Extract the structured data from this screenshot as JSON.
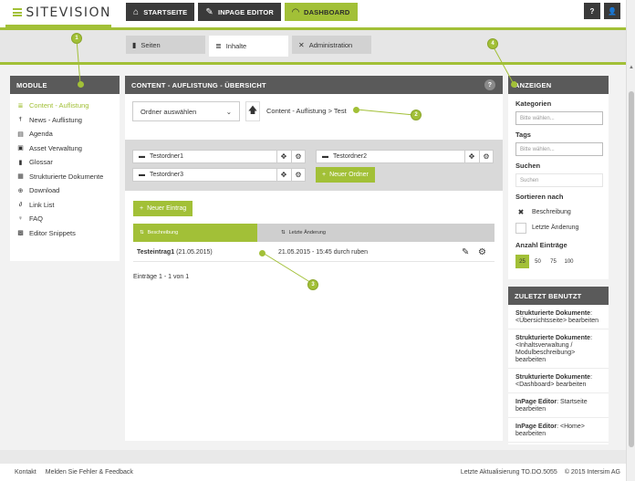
{
  "brand": {
    "logo_text": "SITEVISION"
  },
  "topnav": [
    {
      "label": "STARTSEITE",
      "icon": "home-icon",
      "glyph": "⌂"
    },
    {
      "label": "INPAGE EDITOR",
      "icon": "edit-icon",
      "glyph": "✎"
    },
    {
      "label": "DASHBOARD",
      "icon": "gauge-icon",
      "glyph": "◠"
    }
  ],
  "topicons": {
    "help": "?",
    "user": "👤"
  },
  "subtabs": [
    {
      "label": "Seiten",
      "glyph": "▮"
    },
    {
      "label": "Inhalte",
      "glyph": "≣"
    },
    {
      "label": "Administration",
      "glyph": "✕"
    }
  ],
  "modules": {
    "title": "MODULE",
    "items": [
      {
        "label": "Content - Auflistung",
        "glyph": "≣"
      },
      {
        "label": "News - Auflistung",
        "glyph": "ⲯ"
      },
      {
        "label": "Agenda",
        "glyph": "▤"
      },
      {
        "label": "Asset Verwaltung",
        "glyph": "▣"
      },
      {
        "label": "Glossar",
        "glyph": "▮"
      },
      {
        "label": "Strukturierte Dokumente",
        "glyph": "▦"
      },
      {
        "label": "Download",
        "glyph": "⊕"
      },
      {
        "label": "Link List",
        "glyph": "∂"
      },
      {
        "label": "FAQ",
        "glyph": "♀"
      },
      {
        "label": "Editor Snippets",
        "glyph": "▩"
      }
    ]
  },
  "content": {
    "title": "CONTENT - AUFLISTUNG - ÜBERSICHT",
    "help": "?",
    "folder_select": "Ordner auswählen",
    "breadcrumb": {
      "parent": "Content - Auflistung",
      "sep": ">",
      "current": "Test"
    },
    "folders": [
      "Testordner1",
      "Testordner2",
      "Testordner3"
    ],
    "new_folder_label": "Neuer Ordner",
    "new_entry_label": "Neuer Eintrag",
    "table": {
      "col_description": "Beschreibung",
      "col_changed": "Letzte Änderung",
      "rows": [
        {
          "title": "Testeintrag1",
          "date": "(21.05.2015)",
          "changed": "21.05.2015 - 15:45 durch ruben"
        }
      ]
    },
    "count_text": "Einträge 1 - 1 von 1"
  },
  "anzeigen": {
    "title": "ANZEIGEN",
    "kategorien": {
      "label": "Kategorien",
      "placeholder": "Bitte wählen..."
    },
    "tags": {
      "label": "Tags",
      "placeholder": "Bitte wählen..."
    },
    "suchen": {
      "label": "Suchen",
      "placeholder": "Suchen"
    },
    "sortieren": {
      "label": "Sortieren nach",
      "options": [
        "Beschreibung",
        "Letzte Änderung"
      ]
    },
    "anzahl": {
      "label": "Anzahl Einträge",
      "options": [
        "25",
        "50",
        "75",
        "100"
      ]
    }
  },
  "zuletzt": {
    "title": "ZULETZT BENUTZT",
    "items": [
      {
        "bold": "Strukturierte Dokumente",
        "rest": ": <Übersichtsseite> bearbeiten"
      },
      {
        "bold": "Strukturierte Dokumente",
        "rest": ": <Inhaltsverwaltung / Modulbeschreibung> bearbeiten"
      },
      {
        "bold": "Strukturierte Dokumente",
        "rest": ": <Dashboard> bearbeiten"
      },
      {
        "bold": "InPage Editor",
        "rest": ": Startseite bearbeiten"
      },
      {
        "bold": "InPage Editor",
        "rest": ": <Home> bearbeiten"
      }
    ]
  },
  "callouts": [
    "1",
    "2",
    "3",
    "4"
  ],
  "footer": {
    "links": [
      "Kontakt",
      "Melden Sie Fehler & Feedback"
    ],
    "updated": "Letzte Aktualisierung TO.DO.5055",
    "copyright": "© 2015 Intersim AG"
  },
  "colors": {
    "accent": "#a2c037",
    "dark": "#3a3a3a",
    "panel_head": "#5a5a5a"
  }
}
